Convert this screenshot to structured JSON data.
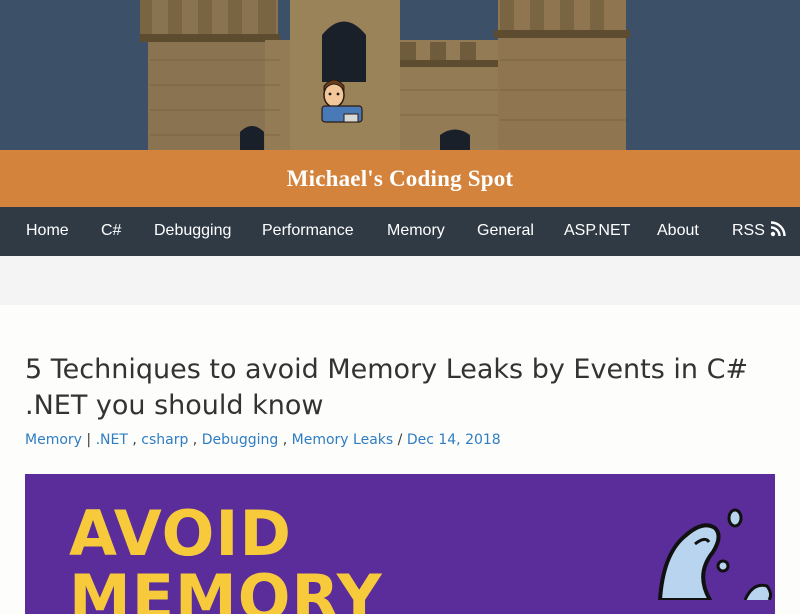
{
  "site": {
    "title": "Michael's Coding Spot"
  },
  "nav": {
    "items": [
      {
        "label": "Home"
      },
      {
        "label": "C#"
      },
      {
        "label": "Debugging"
      },
      {
        "label": "Performance"
      },
      {
        "label": "Memory"
      },
      {
        "label": "General"
      },
      {
        "label": "ASP.NET"
      },
      {
        "label": "About"
      },
      {
        "label": "RSS",
        "icon": "rss-icon"
      }
    ]
  },
  "post": {
    "title": "5 Techniques to avoid Memory Leaks by Events in C# .NET you should know",
    "meta": {
      "category": "Memory",
      "sep1": " | ",
      "tags": [
        ".NET",
        "csharp",
        "Debugging",
        "Memory Leaks"
      ],
      "tag_sep": " , ",
      "date_sep": " / ",
      "date": "Dec 14, 2018"
    },
    "image": {
      "line1": "AVOID",
      "line2": "MEMORY"
    }
  },
  "colors": {
    "banner_sky": "#3c5068",
    "title_bar": "#d3833c",
    "nav_bg": "#2f3a45",
    "link": "#2f7dc2",
    "featured_bg": "#5a2d9a",
    "featured_text": "#f7ca3c"
  }
}
